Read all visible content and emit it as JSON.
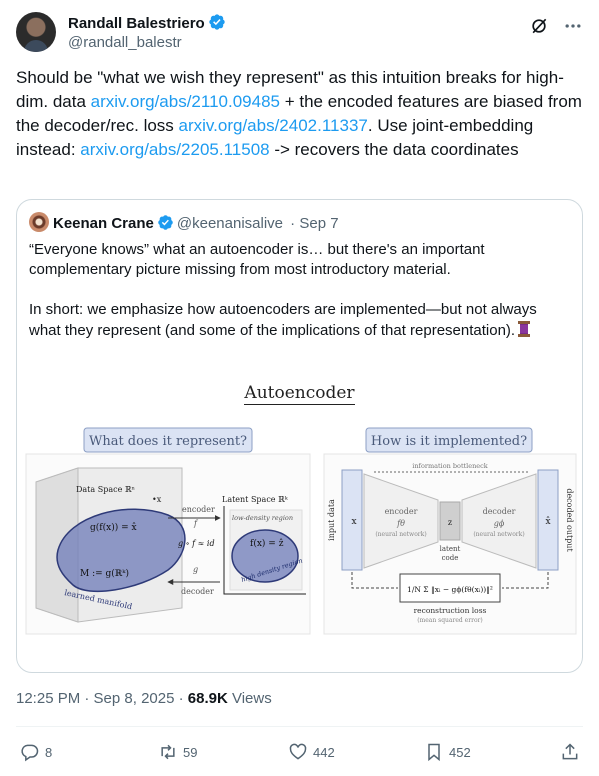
{
  "author": {
    "name": "Randall Balestriero",
    "handle": "@randall_balestr"
  },
  "tweet": {
    "t1": "Should be \"what we wish they represent\" as this intuition breaks for high-dim. data ",
    "link1": "arxiv.org/abs/2110.09485",
    "t2": " + the encoded features are biased from the decoder/rec. loss ",
    "link2": "arxiv.org/abs/2402.11337",
    "t3": ". Use joint-embedding instead: ",
    "link3": "arxiv.org/abs/2205.11508",
    "t4": " -> recovers the data coordinates"
  },
  "quote": {
    "name": "Keenan Crane",
    "handle": "@keenanisalive",
    "sep": " · ",
    "date": "Sep 7",
    "p1": "“Everyone knows” what an autoencoder is… but there's an important complementary picture missing from most introductory material.",
    "p2": "In short: we emphasize how autoencoders are implemented—but not always what they represent (and some of the implications of that representation)."
  },
  "figure": {
    "title": "Autoencoder",
    "left_box": "What does it represent?",
    "right_box": "How is it implemented?",
    "data_space": "Data Space ℝⁿ",
    "latent_space": "Latent Space ℝᵏ",
    "encoder_f": "encoder",
    "f_sym": "f",
    "decoder_g": "decoder",
    "g_sym": "g",
    "gof": "g ∘ f ≈ id",
    "gfx": "g(f(x)) = x̂",
    "fx": "f(x) = ẑ",
    "x_mark": "•x",
    "low_density": "low-density region",
    "high_density": "high density region",
    "manifold": "learned manifold",
    "M_label": "M := g(ℝᵏ)",
    "info_bottleneck": "information bottleneck",
    "input_data": "input data",
    "decoded_output": "decoded output",
    "x_in": "x",
    "x_out": "x̂",
    "enc": "encoder",
    "enc_sym": "fθ",
    "enc_nn": "(neural network)",
    "z": "z",
    "dec": "decoder",
    "dec_sym": "gϕ",
    "dec_nn": "(neural network)",
    "latent": "latent",
    "code": "code",
    "loss_formula": "1/N Σ ‖xᵢ − gϕ(fθ(xᵢ))‖²",
    "recon": "reconstruction loss",
    "mse": "(mean squared error)"
  },
  "meta": {
    "time": "12:25 PM · Sep 8, 2025 · ",
    "views": "68.9K",
    "views_label": " Views"
  },
  "actions": {
    "replies": "8",
    "reposts": "59",
    "likes": "442",
    "bookmarks": "452"
  },
  "colors": {
    "link": "#1d9bf0",
    "verified": "#1d9bf0",
    "secondary": "#536471"
  }
}
